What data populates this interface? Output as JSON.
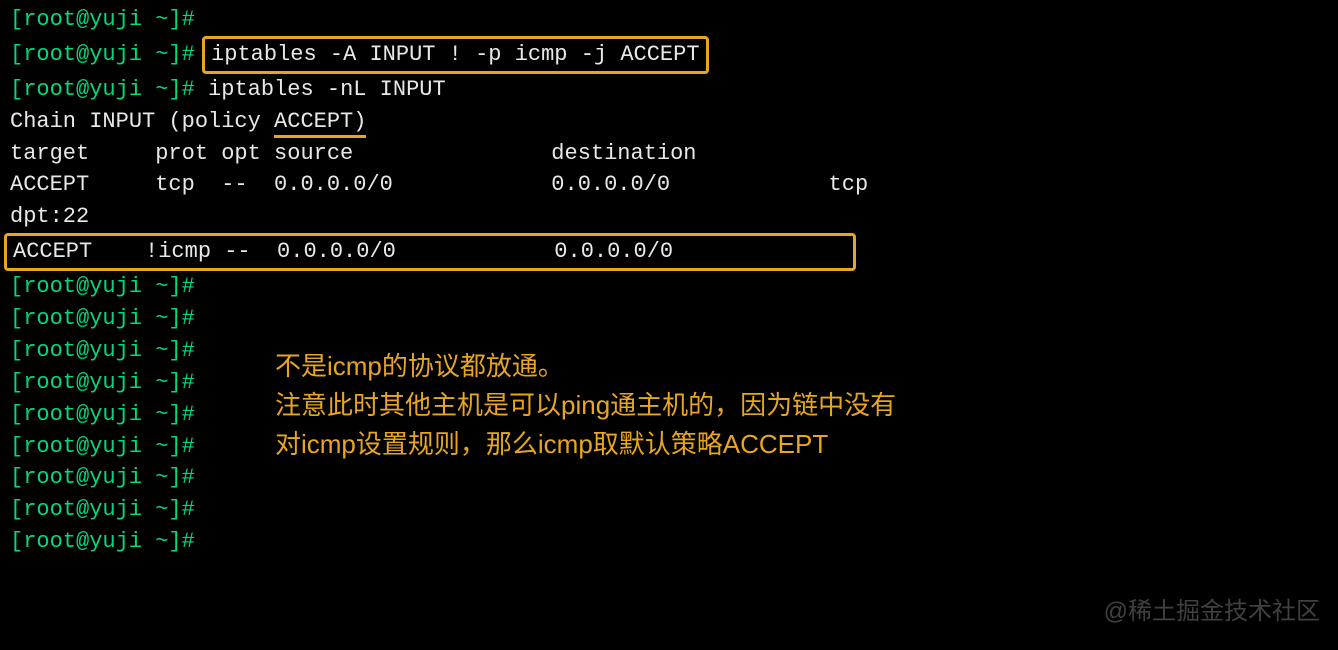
{
  "prompt": "[root@yuji ~]#",
  "commands": {
    "iptables_add": "iptables -A INPUT ! -p icmp -j ACCEPT",
    "iptables_list": "iptables -nL INPUT"
  },
  "chain_header_prefix": "Chain INPUT (policy ",
  "chain_policy": "ACCEPT)",
  "table": {
    "header": "target     prot opt source               destination",
    "row1": "ACCEPT     tcp  --  0.0.0.0/0            0.0.0.0/0            tcp dpt:22",
    "row1_part1": "ACCEPT     tcp  --  0.0.0.0/0            0.0.0.0/0            tcp",
    "row1_part2": "dpt:22",
    "row2": "ACCEPT    !icmp --  0.0.0.0/0            0.0.0.0/0"
  },
  "annotations": {
    "line1": "不是icmp的协议都放通。",
    "line2": "注意此时其他主机是可以ping通主机的，因为链中没有",
    "line3": "对icmp设置规则，那么icmp取默认策略ACCEPT"
  },
  "watermark": "@稀土掘金技术社区"
}
